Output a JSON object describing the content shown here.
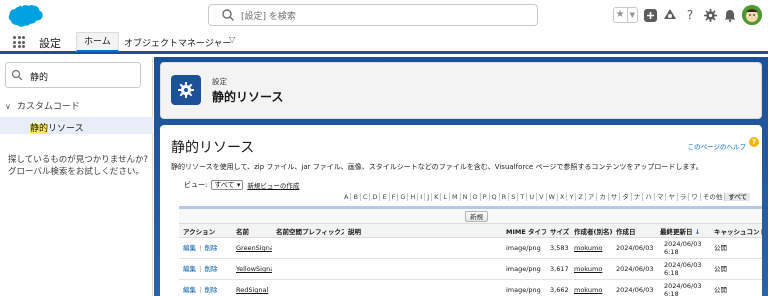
{
  "header": {
    "search_placeholder": "[設定] を検索"
  },
  "app_bar": {
    "app_name": "設定",
    "tabs": [
      {
        "label": "ホーム",
        "active": true
      },
      {
        "label": "オブジェクトマネージャー",
        "active": false
      }
    ]
  },
  "sidebar": {
    "search_value": "静的",
    "group_label": "カスタムコード",
    "item_highlight": "静的",
    "item_rest": "リソース",
    "help_line1": "探しているものが見つかりませんか?",
    "help_line2": "グローバル検索をお試しください。"
  },
  "page_header": {
    "subtitle": "設定",
    "title": "静的リソース"
  },
  "content": {
    "title": "静的リソース",
    "help_link": "このページのヘルプ",
    "help_icon_glyph": "?",
    "description": "静的リソースを使用して、zip ファイル、jar ファイル、画像、スタイルシートなどのファイルを含む、Visualforce ページで参照するコンテンツをアップロードします。",
    "view_label": "ビュー:",
    "view_selected": "すべて",
    "new_view_link": "新規ビューの作成",
    "new_button": "新規"
  },
  "alpha_filter": [
    "A",
    "B",
    "C",
    "D",
    "E",
    "F",
    "G",
    "H",
    "I",
    "J",
    "K",
    "L",
    "M",
    "N",
    "O",
    "P",
    "Q",
    "R",
    "S",
    "T",
    "U",
    "V",
    "W",
    "X",
    "Y",
    "Z",
    "ア",
    "カ",
    "サ",
    "タ",
    "ナ",
    "ハ",
    "マ",
    "ヤ",
    "ラ",
    "ワ",
    "その他",
    "すべて"
  ],
  "table": {
    "columns": [
      "アクション",
      "名前",
      "名前空間プレフィックス",
      "説明",
      "MIME タイプ",
      "サイズ",
      "作成者(別名)",
      "作成日",
      "最終更新日",
      "キャッシュコントロール"
    ],
    "sort_indicator": "↓",
    "rows": [
      {
        "edit": "編集",
        "del": "削除",
        "name": "GreenSignal",
        "prefix": "",
        "desc": "",
        "mime": "image/png",
        "size": "3,583",
        "owner": "mokumo",
        "created": "2024/06/03",
        "modified_date": "2024/06/03",
        "modified_time": "6:18",
        "cache": "公開"
      },
      {
        "edit": "編集",
        "del": "削除",
        "name": "YellowSignal",
        "prefix": "",
        "desc": "",
        "mime": "image/png",
        "size": "3,617",
        "owner": "mokumo",
        "created": "2024/06/03",
        "modified_date": "2024/06/03",
        "modified_time": "6:18",
        "cache": "公開"
      },
      {
        "edit": "編集",
        "del": "削除",
        "name": "RedSignal",
        "prefix": "",
        "desc": "",
        "mime": "image/png",
        "size": "3,662",
        "owner": "mokumo",
        "created": "2024/06/03",
        "modified_date": "2024/06/03",
        "modified_time": "6:18",
        "cache": "公開"
      }
    ]
  },
  "colors": {
    "brand_blue": "#1b5297",
    "link_blue": "#0070d2",
    "salesforce_cloud": "#00a1e0"
  }
}
